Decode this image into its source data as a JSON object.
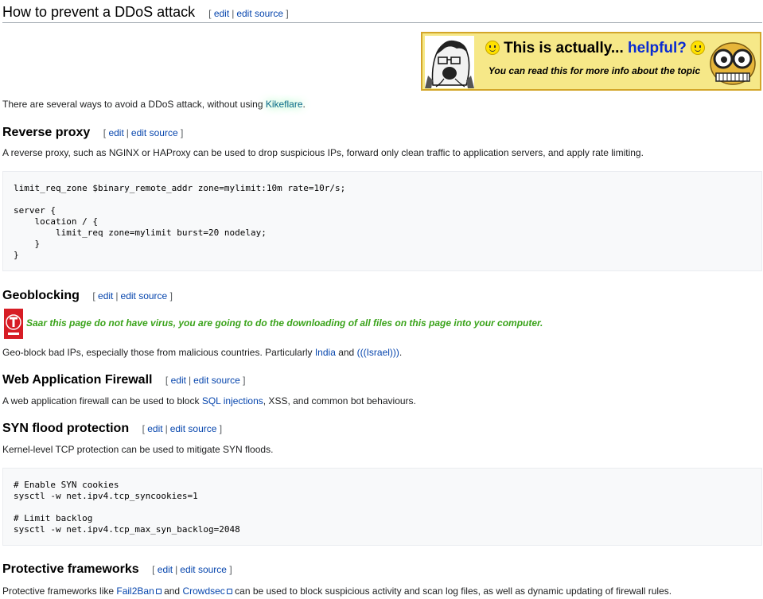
{
  "title": "How to prevent a DDoS attack",
  "editsection": {
    "open": "[",
    "close": "]",
    "edit": "edit",
    "sep": "|",
    "edit_source": "edit source"
  },
  "banner": {
    "title_pre": "This is actually...",
    "title_hl": "helpful?",
    "subtitle": "You can read this for more info about the topic"
  },
  "intro": {
    "pre": "There are several ways to avoid a DDoS attack, without using ",
    "link": "Kikeflare",
    "post": "."
  },
  "sections": {
    "reverse_proxy": {
      "heading": "Reverse proxy",
      "text": "A reverse proxy, such as NGINX or HAProxy can be used to drop suspicious IPs, forward only clean traffic to application servers, and apply rate limiting.",
      "code": "limit_req_zone $binary_remote_addr zone=mylimit:10m rate=10r/s;\n\nserver {\n    location / {\n        limit_req zone=mylimit burst=20 nodelay;\n    }\n}"
    },
    "geoblocking": {
      "heading": "Geoblocking",
      "warning": "Saar this page do not have virus, you are going to do the downloading of all files on this page into your computer.",
      "text_pre": "Geo-block bad IPs, especially those from malicious countries. Particularly ",
      "link1": "India",
      "text_mid": " and ",
      "link2": "(((Israel)))",
      "text_post": "."
    },
    "waf": {
      "heading": "Web Application Firewall",
      "text_pre": "A web application firewall can be used to block ",
      "link": "SQL injections",
      "text_post": ", XSS, and common bot behaviours."
    },
    "syn": {
      "heading": "SYN flood protection",
      "text": "Kernel-level TCP protection can be used to mitigate SYN floods.",
      "code": "# Enable SYN cookies\nsysctl -w net.ipv4.tcp_syncookies=1\n\n# Limit backlog\nsysctl -w net.ipv4.tcp_max_syn_backlog=2048"
    },
    "frameworks": {
      "heading": "Protective frameworks",
      "text_pre": "Protective frameworks like ",
      "link1": "Fail2Ban",
      "text_mid": " and ",
      "link2": "Crowdsec",
      "text_post": " can be used to block suspicious activity and scan log files, as well as dynamic updating of firewall rules."
    }
  },
  "colors": {
    "link": "#0645ad",
    "banner_bg": "#f6e888",
    "banner_border": "#d3a62a",
    "warning_text": "#3aa31a",
    "code_bg": "#f8f9fa"
  },
  "icons": {
    "banner_left": "soyjak-face-icon",
    "banner_right": "nerd-glasses-face-icon",
    "warning": "tseries-logo-icon",
    "smiley": "smiley-icon",
    "external": "external-link-icon"
  }
}
